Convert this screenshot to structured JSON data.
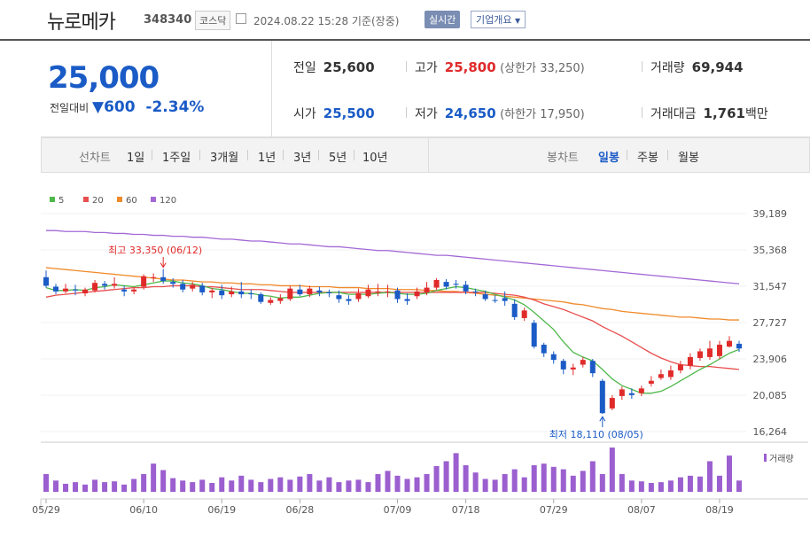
{
  "header": {
    "name": "뉴로메카",
    "code": "348340",
    "market": "코스닥",
    "timestamp": "2024.08.22 15:28 기준(장중)",
    "live_label": "실시간",
    "overview_label": "기업개요"
  },
  "summary": {
    "price": "25,000",
    "change_label": "전일대비",
    "change": "600",
    "change_pct": "-2.34%",
    "prev_close": {
      "label": "전일",
      "value": "25,600"
    },
    "open": {
      "label": "시가",
      "value": "25,500"
    },
    "high": {
      "label": "고가",
      "value": "25,800",
      "limit": "(상한가 33,250)"
    },
    "low": {
      "label": "저가",
      "value": "24,650",
      "limit": "(하한가 17,950)"
    },
    "volume": {
      "label": "거래량",
      "value": "69,944"
    },
    "amount": {
      "label": "거래대금",
      "value": "1,761",
      "unit": "백만"
    }
  },
  "tabs": {
    "line_label": "선차트",
    "line_items": [
      "1일",
      "1주일",
      "3개월",
      "1년",
      "3년",
      "5년",
      "10년"
    ],
    "candle_label": "봉차트",
    "candle_items": [
      "일봉",
      "주봉",
      "월봉"
    ],
    "selected_candle": "일봉"
  },
  "chart_data": {
    "type": "candlestick",
    "legend": [
      {
        "name": "5",
        "color": "#4fb84a"
      },
      {
        "name": "20",
        "color": "#e94e4e"
      },
      {
        "name": "60",
        "color": "#f08a2a"
      },
      {
        "name": "120",
        "color": "#a368d6"
      }
    ],
    "y_ticks": [
      39189,
      35368,
      31547,
      27727,
      23906,
      20085,
      16264
    ],
    "ylim": [
      16264,
      39189
    ],
    "x_ticks": [
      "05/29",
      "06/10",
      "06/19",
      "06/28",
      "07/09",
      "07/18",
      "07/29",
      "08/07",
      "08/19"
    ],
    "annotations": {
      "high": "최고 33,350 (06/12)",
      "low": "최저 18,110 (08/05)"
    },
    "volume_label": "거래량",
    "candles": [
      [
        32500,
        31600,
        33200,
        31400
      ],
      [
        31500,
        31000,
        31800,
        30700
      ],
      [
        31000,
        31300,
        31800,
        30800
      ],
      [
        31200,
        31100,
        31700,
        30600
      ],
      [
        30800,
        31200,
        31400,
        30500
      ],
      [
        31100,
        31900,
        32200,
        30900
      ],
      [
        31800,
        31600,
        32100,
        31200
      ],
      [
        31600,
        31800,
        32500,
        31300
      ],
      [
        31200,
        31000,
        31600,
        30500
      ],
      [
        31000,
        31200,
        31400,
        30700
      ],
      [
        31500,
        32600,
        32800,
        31200
      ],
      [
        32400,
        32500,
        32900,
        32000
      ],
      [
        32500,
        32100,
        33350,
        31800
      ],
      [
        32000,
        31800,
        32400,
        31400
      ],
      [
        31800,
        31200,
        32200,
        30900
      ],
      [
        31300,
        31700,
        32000,
        31000
      ],
      [
        31600,
        30900,
        31900,
        30600
      ],
      [
        30900,
        31100,
        31400,
        30300
      ],
      [
        31100,
        30600,
        31700,
        30200
      ],
      [
        30700,
        31000,
        31500,
        30400
      ],
      [
        31000,
        30700,
        32000,
        30300
      ],
      [
        30800,
        30700,
        31200,
        30200
      ],
      [
        30700,
        29900,
        30900,
        29700
      ],
      [
        29800,
        30100,
        30400,
        29600
      ],
      [
        30000,
        30300,
        30700,
        29700
      ],
      [
        30200,
        31300,
        31600,
        30000
      ],
      [
        31200,
        30700,
        31700,
        30500
      ],
      [
        30700,
        31300,
        31600,
        30400
      ],
      [
        31100,
        30900,
        31500,
        30500
      ],
      [
        30900,
        30800,
        31200,
        30400
      ],
      [
        30600,
        30200,
        31100,
        29800
      ],
      [
        30200,
        30000,
        30600,
        29600
      ],
      [
        30200,
        30800,
        31300,
        29900
      ],
      [
        30500,
        31200,
        31700,
        30300
      ],
      [
        31000,
        31000,
        31800,
        30500
      ],
      [
        31000,
        31000,
        31700,
        30400
      ],
      [
        31100,
        30200,
        31400,
        29800
      ],
      [
        30200,
        30000,
        30800,
        29600
      ],
      [
        30500,
        31000,
        31400,
        30200
      ],
      [
        30900,
        31400,
        32000,
        30600
      ],
      [
        31400,
        32200,
        32400,
        31100
      ],
      [
        32000,
        31500,
        32300,
        31200
      ],
      [
        31800,
        31700,
        32200,
        31300
      ],
      [
        31700,
        31000,
        32100,
        30700
      ],
      [
        31000,
        30900,
        31300,
        30500
      ],
      [
        30700,
        30200,
        31100,
        30000
      ],
      [
        30100,
        30000,
        30600,
        29800
      ],
      [
        30300,
        30000,
        31000,
        29500
      ],
      [
        29700,
        28300,
        30200,
        28000
      ],
      [
        28200,
        29000,
        29300,
        27900
      ],
      [
        27700,
        25200,
        28000,
        25000
      ],
      [
        25400,
        24500,
        25600,
        24100
      ],
      [
        24400,
        23800,
        24700,
        23400
      ],
      [
        23700,
        22800,
        23900,
        22300
      ],
      [
        22800,
        23000,
        23400,
        22200
      ],
      [
        23300,
        23800,
        24100,
        23000
      ],
      [
        23700,
        22400,
        23900,
        22000
      ],
      [
        21600,
        18200,
        21800,
        18110
      ],
      [
        18700,
        19800,
        20100,
        18500
      ],
      [
        20000,
        20700,
        21000,
        19600
      ],
      [
        20300,
        20100,
        20800,
        19700
      ],
      [
        20300,
        20800,
        21100,
        20000
      ],
      [
        21300,
        21600,
        22100,
        21000
      ],
      [
        21900,
        22300,
        22800,
        21700
      ],
      [
        22000,
        22700,
        23200,
        21700
      ],
      [
        22700,
        23300,
        23700,
        22400
      ],
      [
        23200,
        24100,
        24500,
        22800
      ],
      [
        24000,
        24700,
        25000,
        23700
      ],
      [
        24100,
        25000,
        25800,
        23800
      ],
      [
        24200,
        25400,
        25800,
        23900
      ],
      [
        25200,
        25800,
        26300,
        25100
      ],
      [
        25500,
        25000,
        25800,
        24650
      ]
    ],
    "volume": [
      22,
      14,
      10,
      12,
      9,
      15,
      12,
      13,
      9,
      16,
      22,
      35,
      27,
      17,
      14,
      12,
      15,
      11,
      18,
      14,
      20,
      15,
      12,
      16,
      18,
      15,
      19,
      22,
      14,
      18,
      12,
      14,
      15,
      12,
      22,
      26,
      20,
      16,
      18,
      22,
      32,
      38,
      48,
      33,
      24,
      16,
      15,
      22,
      28,
      18,
      33,
      35,
      31,
      28,
      20,
      26,
      38,
      22,
      55,
      22,
      14,
      13,
      11,
      12,
      14,
      18,
      20,
      19,
      38,
      20,
      45,
      14
    ],
    "ma5": [
      31400,
      31100,
      31100,
      31200,
      31100,
      31400,
      31500,
      31700,
      31600,
      31500,
      31700,
      31900,
      32100,
      32100,
      31900,
      31800,
      31600,
      31300,
      31200,
      31000,
      30800,
      30800,
      30600,
      30500,
      30300,
      30400,
      30400,
      30600,
      30800,
      30900,
      30900,
      30700,
      30700,
      30700,
      30800,
      30900,
      30800,
      30700,
      30700,
      30800,
      31100,
      31300,
      31500,
      31400,
      31200,
      31000,
      30700,
      30400,
      30100,
      29600,
      28800,
      27900,
      27000,
      25700,
      24600,
      24100,
      23700,
      22800,
      21800,
      21100,
      20700,
      20300,
      20300,
      20500,
      21000,
      21600,
      22200,
      22800,
      23300,
      23900,
      24500,
      24900
    ],
    "ma20": [
      30400,
      30600,
      30700,
      30800,
      30900,
      31000,
      31100,
      31200,
      31300,
      31400,
      31400,
      31500,
      31500,
      31600,
      31600,
      31600,
      31500,
      31500,
      31400,
      31300,
      31200,
      31200,
      31200,
      31100,
      31000,
      30900,
      30900,
      30900,
      30900,
      30900,
      30900,
      30900,
      30900,
      30900,
      30900,
      30900,
      30900,
      30900,
      30900,
      30900,
      30900,
      30900,
      30900,
      30900,
      30900,
      30900,
      30800,
      30700,
      30600,
      30400,
      30100,
      29700,
      29400,
      29100,
      28700,
      28300,
      27900,
      27300,
      26800,
      26300,
      25700,
      25100,
      24500,
      24000,
      23600,
      23300,
      23200,
      23100,
      23100,
      23000,
      22900,
      22800
    ],
    "ma60": [
      33500,
      33400,
      33300,
      33200,
      33100,
      33000,
      32900,
      32800,
      32700,
      32600,
      32500,
      32400,
      32300,
      32200,
      32200,
      32100,
      32000,
      32000,
      31900,
      31900,
      31800,
      31800,
      31700,
      31700,
      31600,
      31600,
      31600,
      31500,
      31500,
      31500,
      31400,
      31400,
      31400,
      31300,
      31300,
      31300,
      31200,
      31200,
      31200,
      31100,
      31100,
      31000,
      31000,
      30900,
      30800,
      30700,
      30600,
      30500,
      30400,
      30300,
      30200,
      30100,
      30000,
      29900,
      29700,
      29600,
      29400,
      29200,
      29100,
      28900,
      28800,
      28700,
      28600,
      28500,
      28400,
      28300,
      28300,
      28200,
      28100,
      28100,
      28000,
      28000
    ],
    "ma120": [
      37400,
      37400,
      37300,
      37300,
      37300,
      37200,
      37200,
      37100,
      37100,
      37000,
      37000,
      36900,
      36900,
      36800,
      36800,
      36700,
      36700,
      36600,
      36500,
      36500,
      36400,
      36300,
      36300,
      36200,
      36100,
      36000,
      36000,
      35900,
      35800,
      35700,
      35700,
      35600,
      35500,
      35400,
      35300,
      35300,
      35200,
      35100,
      35000,
      34900,
      34800,
      34800,
      34700,
      34600,
      34500,
      34400,
      34300,
      34200,
      34100,
      34000,
      33900,
      33800,
      33700,
      33600,
      33500,
      33400,
      33300,
      33200,
      33100,
      33000,
      32900,
      32800,
      32700,
      32600,
      32500,
      32400,
      32300,
      32200,
      32100,
      32000,
      31900,
      31800
    ]
  }
}
